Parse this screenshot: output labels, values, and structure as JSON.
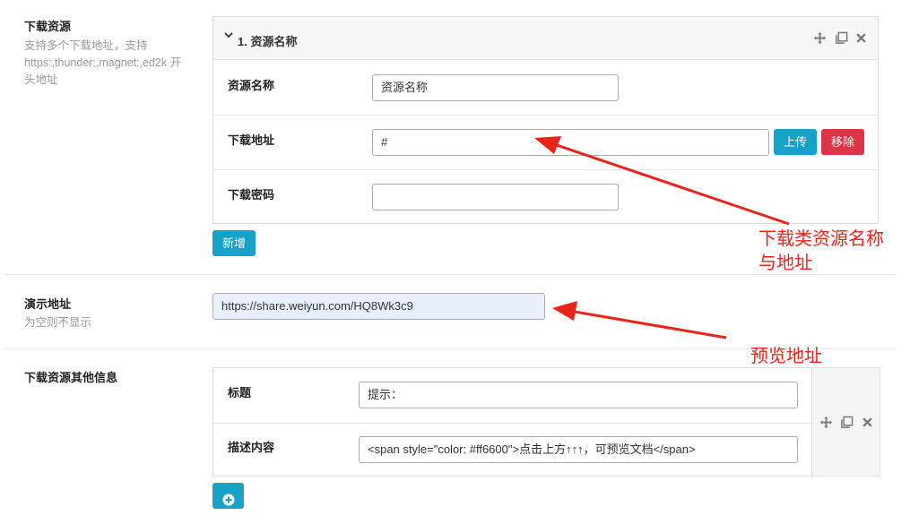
{
  "download_resources": {
    "title": "下载资源",
    "desc_line1": "支持多个下载地址，支持",
    "desc_line2": "https:,thunder:,magnet:,ed2k 开",
    "desc_line3": "头地址",
    "item_header": "1. 资源名称",
    "name_label": "资源名称",
    "name_value": "资源名称",
    "url_label": "下载地址",
    "url_value": "#",
    "upload_label": "上传",
    "remove_label": "移除",
    "password_label": "下载密码",
    "password_value": "",
    "add_label": "新增"
  },
  "demo": {
    "title": "演示地址",
    "desc": "为空则不显示",
    "value": "https://share.weiyun.com/HQ8Wk3c9"
  },
  "other_info": {
    "title": "下载资源其他信息",
    "title_label": "标题",
    "title_value": "提示：",
    "desc_label": "描述内容",
    "desc_value": "<span style=\"color: #ff6600\">点击上方↑↑↑，可预览文档</span>"
  },
  "annotations": {
    "line1": "下载类资源名称",
    "line2": "与地址",
    "preview": "预览地址"
  },
  "colors": {
    "annotation": "#e8241b",
    "primary_button": "#17a2c8",
    "danger_button": "#dc3545",
    "demo_input_bg": "#e8f0fe"
  },
  "icons": [
    "chevron-down-icon",
    "move-icon",
    "copy-icon",
    "close-icon",
    "plus-circle-icon"
  ]
}
